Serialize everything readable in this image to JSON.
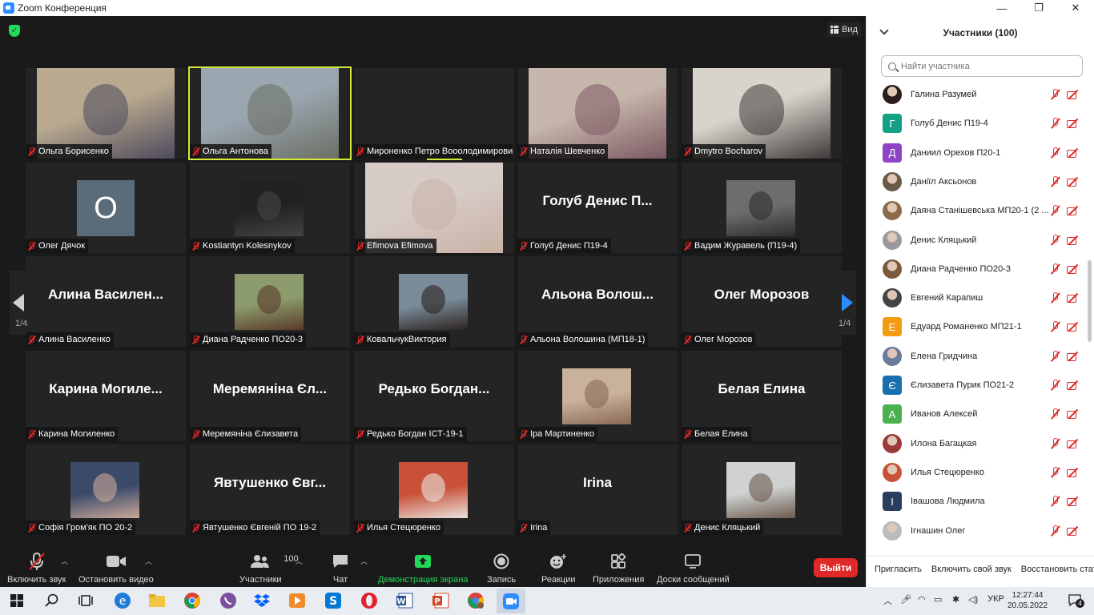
{
  "window": {
    "title": "Zoom Конференция",
    "min": "—",
    "max": "❐",
    "close": "✕"
  },
  "meeting": {
    "view_label": "Вид",
    "page_left": "1/4",
    "page_right": "1/4",
    "tiles": [
      {
        "name": "Ольга Борисенко",
        "kind": "video",
        "bg": "#b9a98f",
        "fg": "#4d4a5c"
      },
      {
        "name": "Ольга Антонова",
        "kind": "video",
        "bg": "#9aa6b0",
        "fg": "#6b6f64",
        "active": true
      },
      {
        "name": "Мироненко Петро Вооолодимирович...",
        "kind": "empty"
      },
      {
        "name": "Наталія Шевченко",
        "kind": "video",
        "bg": "#c6b6ab",
        "fg": "#7c5a62"
      },
      {
        "name": "Dmytro Bocharov",
        "kind": "video",
        "bg": "#d9d4cb",
        "fg": "#3f3a3a"
      },
      {
        "name": "Олег Дячок",
        "kind": "letter",
        "letter": "O"
      },
      {
        "name": "Kostiantyn Kolesnykov",
        "kind": "photo",
        "bg": "#222222",
        "fg": "#444444"
      },
      {
        "name": "Efimova Efimova",
        "kind": "video",
        "bg": "#d7ccc7",
        "fg": "#c9b2a5"
      },
      {
        "name": "Голуб Денис П19-4",
        "kind": "text",
        "big": "Голуб Денис П..."
      },
      {
        "name": "Вадим Журавель (П19-4)",
        "kind": "photo",
        "bg": "#6d6d6d",
        "fg": "#2e2e2e"
      },
      {
        "name": "Алина Василенко",
        "kind": "text",
        "big": "Алина Василен..."
      },
      {
        "name": "Диана Радченко ПО20-3",
        "kind": "photo",
        "bg": "#8b9b6b",
        "fg": "#5a3a2a"
      },
      {
        "name": "КовальчукВиктория",
        "kind": "photo",
        "bg": "#7a8c9a",
        "fg": "#2d2320"
      },
      {
        "name": "Альона Волошина (МП18-1)",
        "kind": "text",
        "big": "Альона Волош..."
      },
      {
        "name": "Олег Морозов",
        "kind": "text",
        "big": "Олег Морозов"
      },
      {
        "name": "Карина Могиленко",
        "kind": "text",
        "big": "Карина Могиле..."
      },
      {
        "name": "Меремяніна Єлизавета",
        "kind": "text",
        "big": "Меремяніна Єл..."
      },
      {
        "name": "Редько Богдан ІСТ-19-1",
        "kind": "text",
        "big": "Редько Богдан..."
      },
      {
        "name": "Іра Мартиненко",
        "kind": "photo",
        "bg": "#c9b29a",
        "fg": "#8a6a55"
      },
      {
        "name": "Белая Елина",
        "kind": "text",
        "big": "Белая Елина"
      },
      {
        "name": "Софія Гром'як ПО 20-2",
        "kind": "photo",
        "bg": "#3c4a6a",
        "fg": "#c9a898"
      },
      {
        "name": "Явтушенко Євгеній ПО 19-2",
        "kind": "text",
        "big": "Явтушенко Євг..."
      },
      {
        "name": "Илья Стецюренко",
        "kind": "photo",
        "bg": "#c9513a",
        "fg": "#e8e2dc"
      },
      {
        "name": "Irina",
        "kind": "text",
        "big": "Irina"
      },
      {
        "name": "Денис Кляцький",
        "kind": "photo",
        "bg": "#cfd2d0",
        "fg": "#6a5a50"
      }
    ]
  },
  "toolbar": {
    "mute": "Включить звук",
    "video": "Остановить видео",
    "participants": "Участники",
    "participants_count": "100",
    "chat": "Чат",
    "share": "Демонстрация экрана",
    "record": "Запись",
    "reactions": "Реакции",
    "apps": "Приложения",
    "whiteboards": "Доски сообщений",
    "leave": "Выйти"
  },
  "panel": {
    "title": "Участники (100)",
    "search_placeholder": "Найти участника",
    "participants": [
      {
        "name": "Галина Разумей",
        "avatar": "photo",
        "color": "#2a1f1c"
      },
      {
        "name": "Голуб Денис П19-4",
        "avatar": "letter",
        "letter": "Г",
        "color": "#14a085"
      },
      {
        "name": "Даниил Орехов П20-1",
        "avatar": "letter",
        "letter": "Д",
        "color": "#8e44c4"
      },
      {
        "name": "Даніїл Аксьонов",
        "avatar": "photo",
        "color": "#6a5a4a"
      },
      {
        "name": "Даяна Станішевська МП20-1 (2 ...",
        "avatar": "photo",
        "color": "#8a6a4a"
      },
      {
        "name": "Денис Кляцький",
        "avatar": "photo",
        "color": "#9a9a9a"
      },
      {
        "name": "Диана Радченко ПО20-3",
        "avatar": "photo",
        "color": "#7a5a3a"
      },
      {
        "name": "Евгений Карапиш",
        "avatar": "photo",
        "color": "#444444"
      },
      {
        "name": "Едуард Романенко МП21-1",
        "avatar": "letter",
        "letter": "Е",
        "color": "#f39c12"
      },
      {
        "name": "Елена Гридчина",
        "avatar": "photo",
        "color": "#6a7a9a"
      },
      {
        "name": "Єлизавета Пурик ПО21-2",
        "avatar": "letter",
        "letter": "Є",
        "color": "#1a6fb0"
      },
      {
        "name": "Иванов Алексей",
        "avatar": "letter",
        "letter": "А",
        "color": "#4caf50"
      },
      {
        "name": "Илона Багацкая",
        "avatar": "photo",
        "color": "#9a3a3a"
      },
      {
        "name": "Илья Стецюренко",
        "avatar": "photo",
        "color": "#c9513a"
      },
      {
        "name": "Івашова Людмила",
        "avatar": "letter",
        "letter": "І",
        "color": "#2c3e60"
      },
      {
        "name": "Ігнашин Олег",
        "avatar": "photo",
        "color": "#bbbbbb"
      }
    ],
    "invite": "Пригласить",
    "unmute_me": "Включить свой звук",
    "restore": "Восстановить стату"
  },
  "taskbar": {
    "lang": "УКР",
    "time": "12:27:44",
    "date": "20.05.2022",
    "notif": "4"
  }
}
